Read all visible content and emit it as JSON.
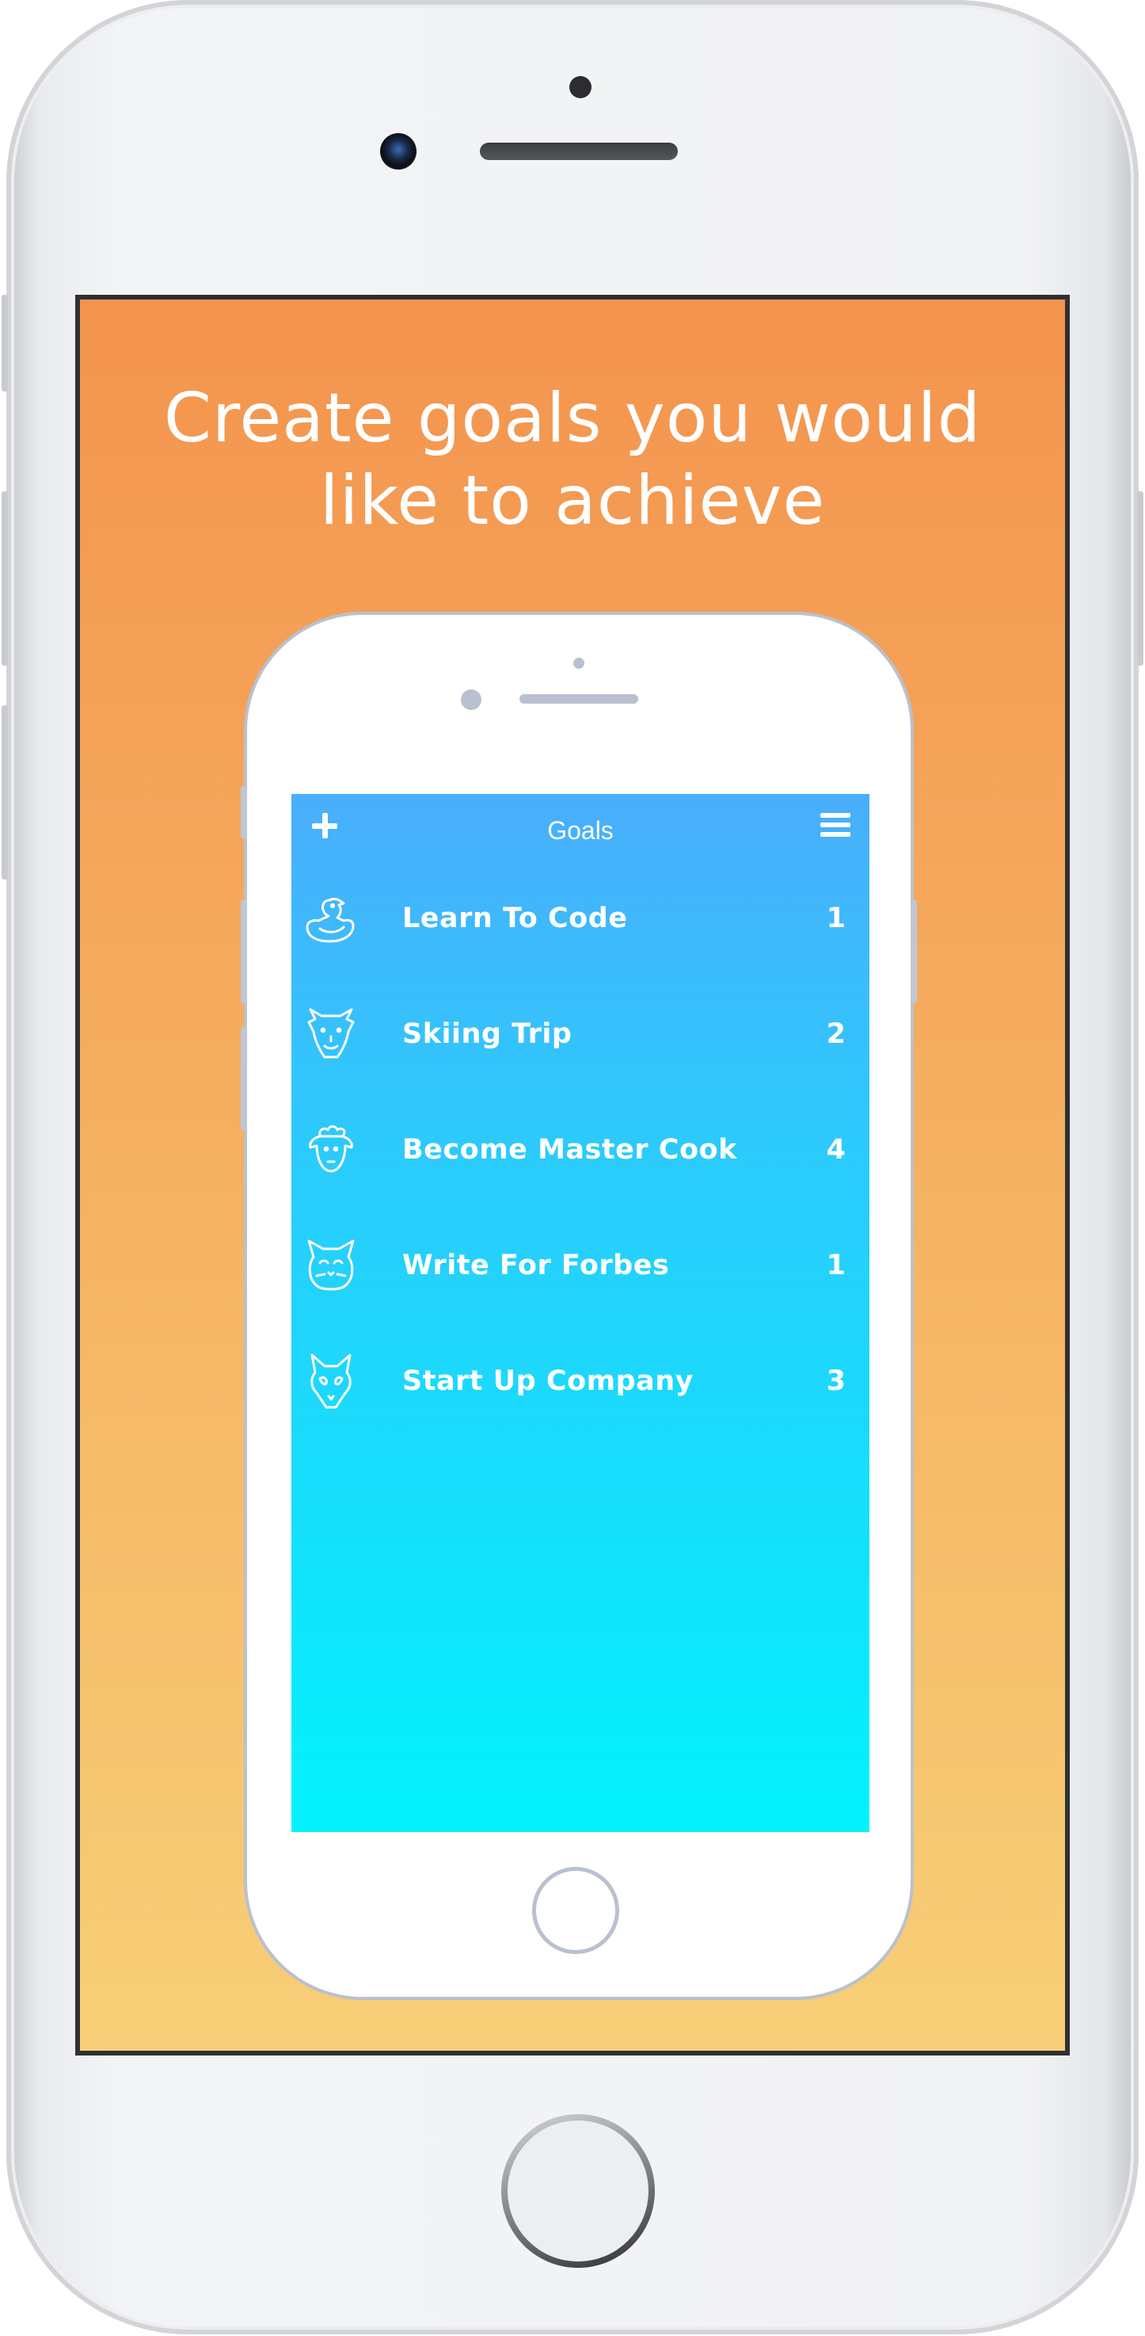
{
  "headline": "Create goals you would\nlike to achieve",
  "app": {
    "header": {
      "title": "Goals",
      "add_icon": "plus-icon",
      "menu_icon": "hamburger-menu-icon"
    },
    "goals": [
      {
        "name": "Learn To Code",
        "count": "1",
        "icon": "duck-icon"
      },
      {
        "name": "Skiing Trip",
        "count": "2",
        "icon": "camel-icon"
      },
      {
        "name": "Become Master Cook",
        "count": "4",
        "icon": "sheep-icon"
      },
      {
        "name": "Write For Forbes",
        "count": "1",
        "icon": "cat-icon"
      },
      {
        "name": "Start Up Company",
        "count": "3",
        "icon": "fox-icon"
      }
    ]
  },
  "colors": {
    "background_top": "#f4944e",
    "background_bottom": "#f7cf77",
    "app_top": "#4aaefc",
    "app_bottom": "#02f3fb",
    "text": "#ffffff"
  }
}
